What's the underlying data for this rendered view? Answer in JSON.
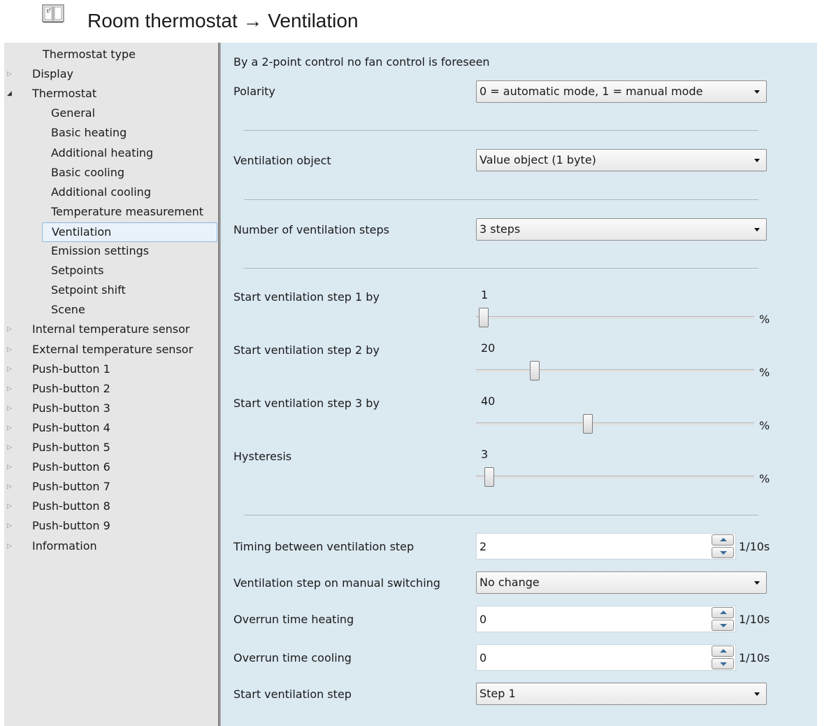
{
  "header": {
    "title": "Room thermostat → Ventilation",
    "icon": "book-icon"
  },
  "sidebar": {
    "items": [
      {
        "label": "Thermostat type",
        "level": 1,
        "expander": "none"
      },
      {
        "label": "Display",
        "level": 0,
        "expander": "collapsed"
      },
      {
        "label": "Thermostat",
        "level": 0,
        "expander": "expanded"
      },
      {
        "label": "General",
        "level": 2,
        "expander": "none"
      },
      {
        "label": "Basic heating",
        "level": 2,
        "expander": "none"
      },
      {
        "label": "Additional heating",
        "level": 2,
        "expander": "none"
      },
      {
        "label": "Basic cooling",
        "level": 2,
        "expander": "none"
      },
      {
        "label": "Additional cooling",
        "level": 2,
        "expander": "none"
      },
      {
        "label": "Temperature measurement",
        "level": 2,
        "expander": "none"
      },
      {
        "label": "Ventilation",
        "level": 2,
        "expander": "none",
        "selected": true
      },
      {
        "label": "Emission settings",
        "level": 2,
        "expander": "none"
      },
      {
        "label": "Setpoints",
        "level": 2,
        "expander": "none"
      },
      {
        "label": "Setpoint shift",
        "level": 2,
        "expander": "none"
      },
      {
        "label": "Scene",
        "level": 2,
        "expander": "none"
      },
      {
        "label": "Internal temperature sensor",
        "level": 0,
        "expander": "collapsed"
      },
      {
        "label": "External temperature sensor",
        "level": 0,
        "expander": "collapsed"
      },
      {
        "label": "Push-button 1",
        "level": 0,
        "expander": "collapsed"
      },
      {
        "label": "Push-button 2",
        "level": 0,
        "expander": "collapsed"
      },
      {
        "label": "Push-button 3",
        "level": 0,
        "expander": "collapsed"
      },
      {
        "label": "Push-button 4",
        "level": 0,
        "expander": "collapsed"
      },
      {
        "label": "Push-button 5",
        "level": 0,
        "expander": "collapsed"
      },
      {
        "label": "Push-button 6",
        "level": 0,
        "expander": "collapsed"
      },
      {
        "label": "Push-button 7",
        "level": 0,
        "expander": "collapsed"
      },
      {
        "label": "Push-button 8",
        "level": 0,
        "expander": "collapsed"
      },
      {
        "label": "Push-button 9",
        "level": 0,
        "expander": "collapsed"
      },
      {
        "label": "Information",
        "level": 0,
        "expander": "collapsed"
      }
    ]
  },
  "main": {
    "info_text": "By a 2-point control no fan control is foreseen",
    "polarity": {
      "label": "Polarity",
      "value": "0 = automatic mode, 1 = manual mode"
    },
    "ventilation_object": {
      "label": "Ventilation object",
      "value": "Value object (1 byte)"
    },
    "steps_count": {
      "label": "Number of ventilation steps",
      "value": "3 steps"
    },
    "sliders": [
      {
        "label": "Start ventilation step 1 by",
        "value": "1",
        "level_percent": 1,
        "unit": "%"
      },
      {
        "label": "Start ventilation step 2 by",
        "value": "20",
        "level_percent": 20,
        "unit": "%"
      },
      {
        "label": "Start ventilation step 3 by",
        "value": "40",
        "level_percent": 40,
        "unit": "%"
      },
      {
        "label": "Hysteresis",
        "value": "3",
        "level_percent": 3,
        "unit": "%"
      }
    ],
    "timing": {
      "label": "Timing between ventilation step",
      "value": "2",
      "unit": "1/10s"
    },
    "manual_step": {
      "label": "Ventilation step on manual switching",
      "value": "No change"
    },
    "overrun_heating": {
      "label": "Overrun time heating",
      "value": "0",
      "unit": "1/10s"
    },
    "overrun_cooling": {
      "label": "Overrun time cooling",
      "value": "0",
      "unit": "1/10s"
    },
    "start_step": {
      "label": "Start ventilation step",
      "value": "Step 1"
    }
  }
}
